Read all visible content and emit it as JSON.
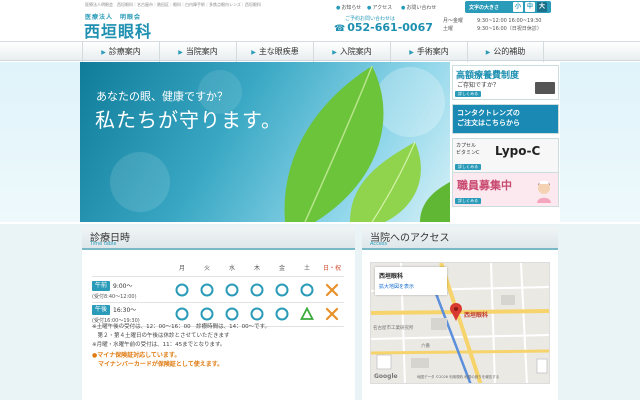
{
  "header": {
    "keywords": "医療法人明眼会　西垣眼科｜名古屋市｜熱田区｜眼科｜白内障手術｜多焦点眼内レンズ｜西垣眼科",
    "logo_small": "医療法人　明眼会",
    "logo_main": "西垣眼科",
    "links": [
      "お知らせ",
      "アクセス",
      "お問い合わせ"
    ],
    "font_size_label": "文字の大きさ",
    "font_sizes": [
      "小",
      "中",
      "大"
    ],
    "tel_note": "ご予約お問い合わせは",
    "tel": "052-661-0067",
    "hours": [
      {
        "day": "月～金曜",
        "time": "9:30~12:00  16:00~19:30"
      },
      {
        "day": "土曜",
        "time": "9:30~16:00（日祝日休診）"
      }
    ]
  },
  "nav": [
    "診療案内",
    "当院案内",
    "主な眼疾患",
    "入院案内",
    "手術案内",
    "公的補助"
  ],
  "hero": {
    "sub": "あなたの眼、健康ですか？",
    "main": "私たちが守ります。"
  },
  "banners": {
    "b1": {
      "title": "高額療養費制度",
      "sub": "ご存知ですか？",
      "more": "詳しくみる"
    },
    "b2": {
      "line1": "コンタクトレンズの",
      "line2": "ご注文はこちらから"
    },
    "b3": {
      "line1": "カプセル",
      "line2": "ビタミンC",
      "logo": "Lypo-C",
      "more": "詳しくみる"
    },
    "b4": {
      "title": "職員募集中",
      "more": "詳しくみる"
    }
  },
  "schedule": {
    "title": "診療日時",
    "subtitle": "Time table",
    "days": [
      "月",
      "火",
      "水",
      "木",
      "金",
      "土",
      "日・祝"
    ],
    "rows": [
      {
        "label": "午前",
        "time": "9:00～",
        "sub": "(受付8:40～12:00)",
        "marks": [
          "circle",
          "circle",
          "circle",
          "circle",
          "circle",
          "circle",
          "cross"
        ]
      },
      {
        "label": "午後",
        "time": "16:30～",
        "sub": "(受付16:00～19:30)",
        "marks": [
          "circle",
          "circle",
          "circle",
          "circle",
          "circle",
          "triangle",
          "cross"
        ]
      }
    ],
    "notes": [
      "※土曜午後の受付は、12：00～16：00　診療時間は、14：00～です。",
      "　第２・第４土曜日の午後は休診とさせていただきます",
      "※月曜・水曜午前の受付は、11：45までとなります。"
    ],
    "notice1": "●マイナ保険証対応しています。",
    "notice2": "　マイナンバーカードが保険証として使えます。"
  },
  "access": {
    "title": "当院へのアクセス",
    "subtitle": "Access",
    "map_name": "西垣眼科",
    "map_link": "拡大地図を表示",
    "pin_label": "西垣眼科",
    "google": "Google",
    "credit": "地図データ ©2026  利用規約  地図の誤りを報告する",
    "labels": [
      "名古屋市工業研究所",
      "六番"
    ]
  },
  "colors": {
    "accent": "#2a9bb8",
    "holiday": "#d04a2a",
    "cross": "#e8902a",
    "triangle": "#3aaa3a"
  }
}
